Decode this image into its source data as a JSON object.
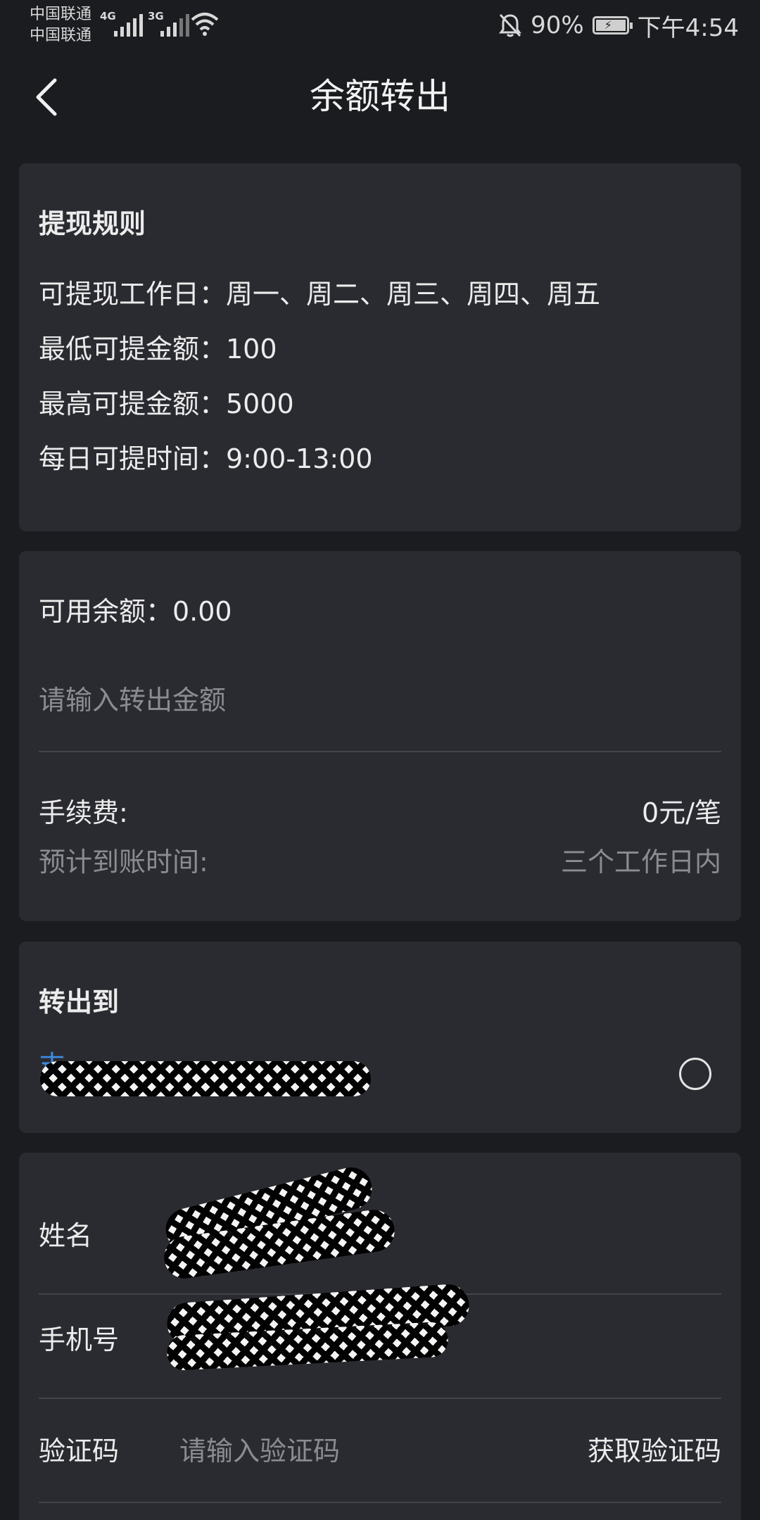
{
  "status_bar": {
    "carrier_1": "中国联通",
    "carrier_2": "中国联通",
    "net_1": "4G",
    "net_2": "3G",
    "battery": "90%",
    "time": "下午4:54"
  },
  "header": {
    "title": "余额转出",
    "back_icon": "chevron-left-icon"
  },
  "rules": {
    "heading": "提现规则",
    "items": [
      "可提现工作日：周一、周二、周三、周四、周五",
      "最低可提金额：100",
      "最高可提金额：5000",
      "每日可提时间：9:00-13:00"
    ]
  },
  "amount": {
    "balance_label": "可用余额：0.00",
    "input_placeholder": "请输入转出金额",
    "fee_label": "手续费:",
    "fee_value": "0元/笔",
    "arrival_label": "预计到账时间:",
    "arrival_value": "三个工作日内"
  },
  "transfer_to": {
    "heading": "转出到",
    "account_prefix": "支"
  },
  "form": {
    "name_label": "姓名",
    "phone_label": "手机号",
    "code_label": "验证码",
    "code_placeholder": "请输入验证码",
    "get_code_button": "获取验证码"
  },
  "colors": {
    "background": "#1b1c20",
    "card": "#2a2b31",
    "text": "#ececec",
    "muted": "#8b8c91",
    "accent_blue": "#3d8be0"
  }
}
